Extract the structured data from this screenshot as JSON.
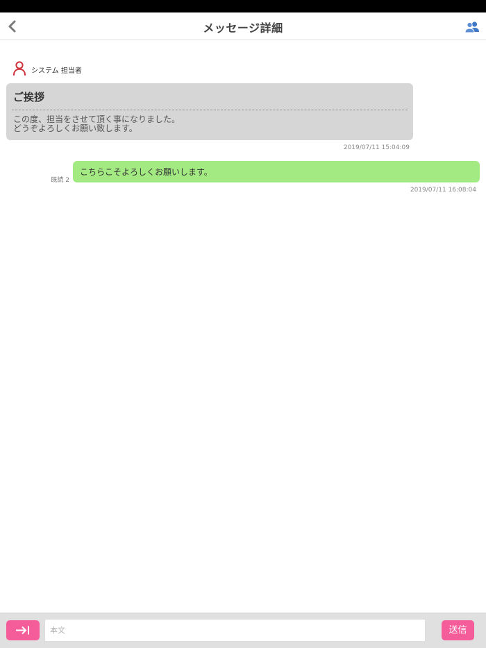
{
  "header": {
    "title": "メッセージ詳細",
    "back_icon": "chevron-left-icon",
    "members_icon": "users-icon",
    "accent": "#3f78c6"
  },
  "messages": [
    {
      "direction": "incoming",
      "sender": "システム 担当者",
      "sender_icon": "person-icon",
      "sender_icon_color": "#d0333b",
      "subject": "ご挨拶",
      "body_lines": [
        "この度、担当をさせて頂く事になりました。",
        "どうぞよろしくお願い致します。"
      ],
      "timestamp": "2019/07/11 15:04:09",
      "bubble_color": "#d6d6d6"
    },
    {
      "direction": "outgoing",
      "read_label": "既読 2",
      "text": "こちらこそよろしくお願いします。",
      "timestamp": "2019/07/11 16:08:04",
      "bubble_color": "#a3ea82"
    }
  ],
  "composer": {
    "attach_icon": "arrow-right-to-bar-icon",
    "placeholder": "本文",
    "value": "",
    "send_label": "送信",
    "button_color": "#f45d9a"
  }
}
